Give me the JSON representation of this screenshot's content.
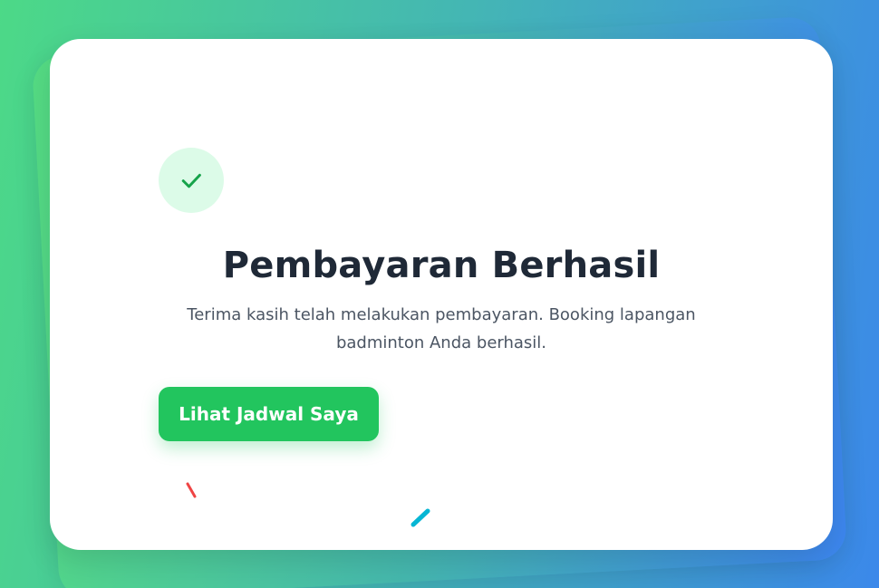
{
  "success_card": {
    "icon": "check-icon",
    "title": "Pembayaran Berhasil",
    "message": "Terima kasih telah melakukan pembayaran. Booking lapangan badminton Anda berhasil.",
    "button_label": "Lihat Jadwal Saya"
  },
  "colors": {
    "accent": "#22c55e",
    "icon_bg": "#dcfbe8",
    "title": "#1f2937",
    "message": "#4b5563",
    "background_start": "#4cd987",
    "background_end": "#3b88ea",
    "confetti_red": "#ef4444",
    "confetti_cyan": "#06b6d4"
  }
}
